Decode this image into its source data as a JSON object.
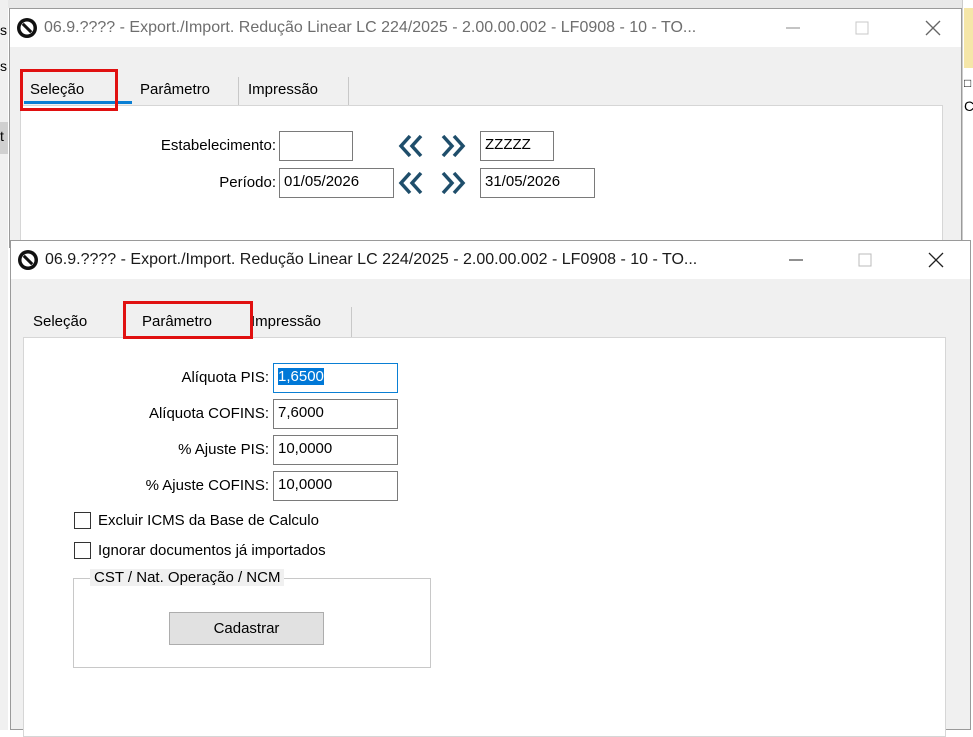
{
  "background": {
    "left_edge_chars": [
      "s",
      "s",
      "t"
    ],
    "right_edge_chars": [
      "□",
      "C"
    ]
  },
  "window1": {
    "title": "06.9.???? - Export./Import. Redução Linear LC 224/2025 - 2.00.00.002 - LF0908 - 10 - TO...",
    "tabs": [
      {
        "label": "Seleção"
      },
      {
        "label": "Parâmetro"
      },
      {
        "label": "Impressão"
      }
    ],
    "fields": {
      "estabelecimento_label": "Estabelecimento:",
      "estabelecimento_from": "",
      "estabelecimento_to": "ZZZZZ",
      "periodo_label": "Período:",
      "periodo_from": "01/05/2026",
      "periodo_to": "31/05/2026"
    }
  },
  "window2": {
    "title": "06.9.???? - Export./Import. Redução Linear LC 224/2025 - 2.00.00.002 - LF0908 - 10 - TO...",
    "tabs": [
      {
        "label": "Seleção"
      },
      {
        "label": "Parâmetro"
      },
      {
        "label": "Impressão"
      }
    ],
    "fields": [
      {
        "label": "Alíquota PIS:",
        "value": "1,6500"
      },
      {
        "label": "Alíquota COFINS:",
        "value": "7,6000"
      },
      {
        "label": "% Ajuste PIS:",
        "value": "10,0000"
      },
      {
        "label": "% Ajuste COFINS:",
        "value": "10,0000"
      }
    ],
    "checkboxes": [
      {
        "label": "Excluir ICMS da Base de Calculo",
        "checked": false
      },
      {
        "label": "Ignorar documentos já importados",
        "checked": false
      }
    ],
    "group": {
      "title": "CST / Nat. Operação / NCM",
      "button_label": "Cadastrar"
    }
  },
  "colors": {
    "highlight_box": "#e01010",
    "active_tab_underline": "#0a7fd4",
    "nav_arrow": "#1f4e6b",
    "selection": "#0078d7"
  }
}
